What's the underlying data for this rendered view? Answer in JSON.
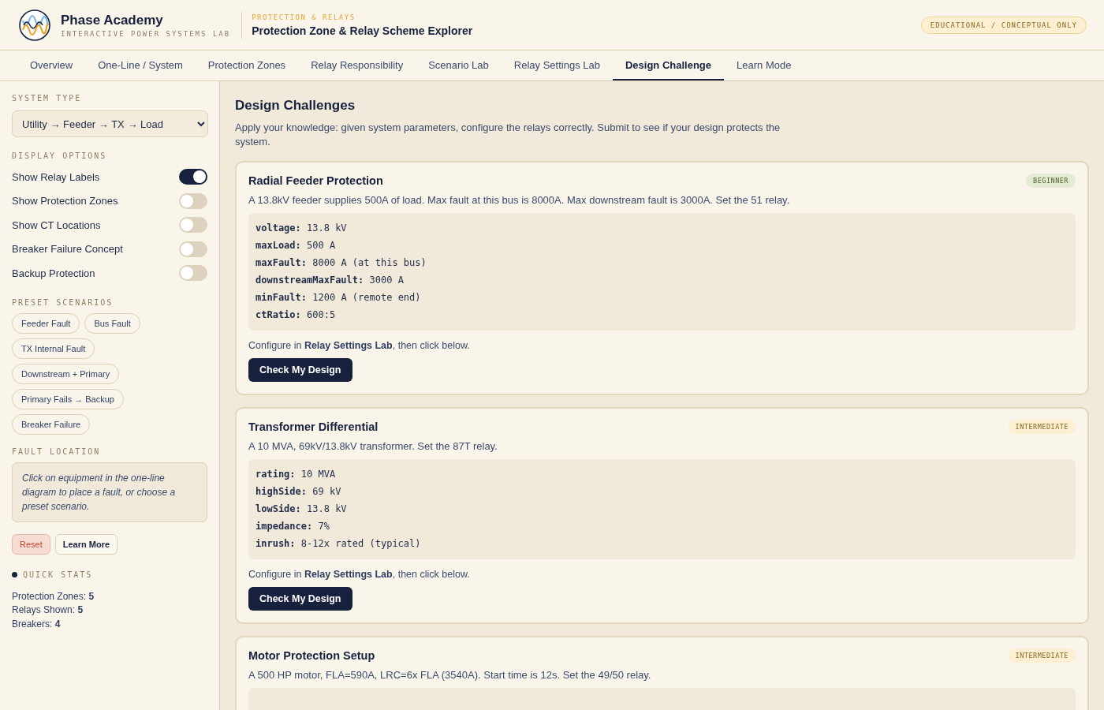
{
  "header": {
    "brand": "Phase Academy",
    "tagline": "INTERACTIVE POWER SYSTEMS LAB",
    "section": "PROTECTION & RELAYS",
    "title": "Protection Zone & Relay Scheme Explorer",
    "badge": "EDUCATIONAL / CONCEPTUAL ONLY"
  },
  "tabs": [
    {
      "label": "Overview",
      "selected": false
    },
    {
      "label": "One-Line / System",
      "selected": false
    },
    {
      "label": "Protection Zones",
      "selected": false
    },
    {
      "label": "Relay Responsibility",
      "selected": false
    },
    {
      "label": "Scenario Lab",
      "selected": false
    },
    {
      "label": "Relay Settings Lab",
      "selected": false
    },
    {
      "label": "Design Challenge",
      "selected": true
    },
    {
      "label": "Learn Mode",
      "selected": false
    }
  ],
  "sidebar": {
    "system_type": {
      "label": "SYSTEM TYPE",
      "value": "Utility → Feeder → TX → Load"
    },
    "display_options": {
      "label": "DISPLAY OPTIONS",
      "items": [
        {
          "label": "Show Relay Labels",
          "on": true
        },
        {
          "label": "Show Protection Zones",
          "on": false
        },
        {
          "label": "Show CT Locations",
          "on": false
        },
        {
          "label": "Breaker Failure Concept",
          "on": false
        },
        {
          "label": "Backup Protection",
          "on": false
        }
      ]
    },
    "presets": {
      "label": "PRESET SCENARIOS",
      "items": [
        "Feeder Fault",
        "Bus Fault",
        "TX Internal Fault",
        "Downstream + Primary",
        "Primary Fails → Backup",
        "Breaker Failure"
      ]
    },
    "fault_location": {
      "label": "FAULT LOCATION",
      "hint": "Click on equipment in the one-line diagram to place a fault, or choose a preset scenario."
    },
    "buttons": [
      {
        "label": "Reset",
        "kind": "danger"
      },
      {
        "label": "Learn More",
        "kind": "plain"
      }
    ],
    "quick_stats": {
      "label": "QUICK STATS",
      "items": [
        {
          "label": "Protection Zones:",
          "value": "5"
        },
        {
          "label": "Relays Shown:",
          "value": "5"
        },
        {
          "label": "Breakers:",
          "value": "4"
        }
      ]
    }
  },
  "main": {
    "title": "Design Challenges",
    "intro": "Apply your knowledge: given system parameters, configure the relays correctly. Submit to see if your design protects the system.",
    "challenges": [
      {
        "title": "Radial Feeder Protection",
        "level": "BEGINNER",
        "kind": "beginner",
        "description": "A 13.8kV feeder supplies 500A of load. Max fault at this bus is 8000A. Max downstream fault is 3000A. Set the 51 relay.",
        "params": [
          {
            "key": "voltage:",
            "value": "13.8 kV"
          },
          {
            "key": "maxLoad:",
            "value": "500 A"
          },
          {
            "key": "maxFault:",
            "value": "8000 A (at this bus)"
          },
          {
            "key": "downstreamMaxFault:",
            "value": "3000 A"
          },
          {
            "key": "minFault:",
            "value": "1200 A (remote end)"
          },
          {
            "key": "ctRatio:",
            "value": "600:5"
          }
        ],
        "note": "Configure in **Relay Settings Lab**, then click below.",
        "button": "Check My Design"
      },
      {
        "title": "Transformer Differential",
        "level": "INTERMEDIATE",
        "kind": "intermediate",
        "description": "A 10 MVA, 69kV/13.8kV transformer. Set the 87T relay.",
        "params": [
          {
            "key": "rating:",
            "value": "10 MVA"
          },
          {
            "key": "highSide:",
            "value": "69 kV"
          },
          {
            "key": "lowSide:",
            "value": "13.8 kV"
          },
          {
            "key": "impedance:",
            "value": "7%"
          },
          {
            "key": "inrush:",
            "value": "8-12x rated (typical)"
          }
        ],
        "note": "Configure in **Relay Settings Lab**, then click below.",
        "button": "Check My Design"
      },
      {
        "title": "Motor Protection Setup",
        "level": "INTERMEDIATE",
        "kind": "intermediate",
        "description": "A 500 HP motor, FLA=590A, LRC=6x FLA (3540A). Start time is 12s. Set the 49/50 relay."
      }
    ]
  }
}
